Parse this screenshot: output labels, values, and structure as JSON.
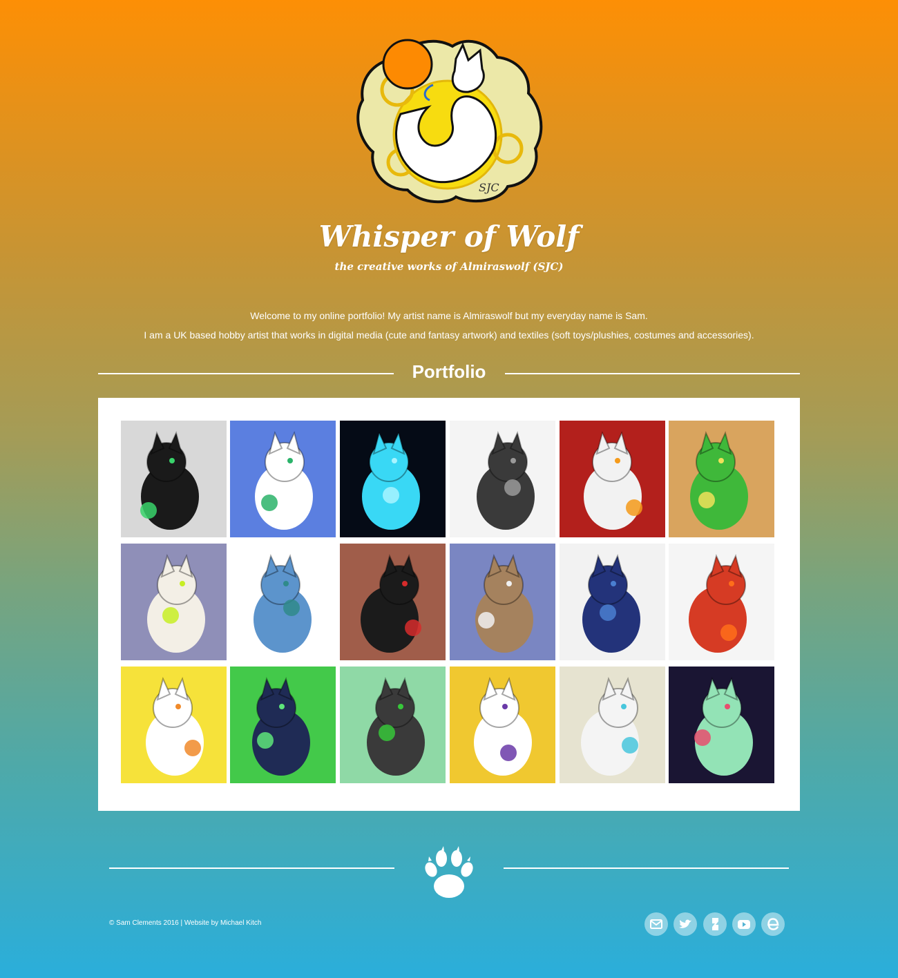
{
  "header": {
    "logo_icon": "sleeping-wolf-logo",
    "logo_signature": "SJC",
    "title": "Whisper of Wolf",
    "subtitle": "the creative works of Almiraswolf (SJC)"
  },
  "intro": {
    "line1": "Welcome to my online portfolio! My artist name is Almiraswolf but my everyday name is Sam.",
    "line2": "I am a UK based hobby artist that works in digital media (cute and fantasy artwork) and textiles (soft toys/plushies, costumes and accessories)."
  },
  "portfolio": {
    "heading": "Portfolio",
    "items": [
      {
        "subject": "black-dragon-costume-photo",
        "bg": "#d8d8d8",
        "fg": "#1a1a1a",
        "accent": "#39d36b"
      },
      {
        "subject": "white-fox-art",
        "bg": "#5b7fe0",
        "fg": "#ffffff",
        "accent": "#2bb36a"
      },
      {
        "subject": "glowing-ice-dragon-art",
        "bg": "#050b16",
        "fg": "#39d8f5",
        "accent": "#a8f4ff"
      },
      {
        "subject": "lineart-eastern-dragon",
        "bg": "#f4f4f4",
        "fg": "#3a3a3a",
        "accent": "#9a9a9a"
      },
      {
        "subject": "fire-wolf-art",
        "bg": "#b3201c",
        "fg": "#f2f2f2",
        "accent": "#f59a1a"
      },
      {
        "subject": "green-dinosaur-art",
        "bg": "#d9a45e",
        "fg": "#3fb83a",
        "accent": "#f0e05a"
      },
      {
        "subject": "white-fleece-dragon-plush",
        "bg": "#8f8fb8",
        "fg": "#f3efe6",
        "accent": "#c7ee24"
      },
      {
        "subject": "blue-dragon-art",
        "bg": "#ffffff",
        "fg": "#5c94cc",
        "accent": "#2f8a8a"
      },
      {
        "subject": "costume-person-photo",
        "bg": "#a05d4a",
        "fg": "#1b1b1b",
        "accent": "#d62b2b"
      },
      {
        "subject": "plush-antlers-collage",
        "bg": "#7a86c2",
        "fg": "#a5825e",
        "accent": "#f0f0f0"
      },
      {
        "subject": "blue-plush-creature",
        "bg": "#f2f2f2",
        "fg": "#23337a",
        "accent": "#4a7fd0"
      },
      {
        "subject": "red-fox-plush",
        "bg": "#f5f5f5",
        "fg": "#d63b24",
        "accent": "#ff6e1a"
      },
      {
        "subject": "almiraswolf-badge-art",
        "bg": "#f6e23a",
        "fg": "#ffffff",
        "accent": "#f08a2a"
      },
      {
        "subject": "green-star-hoodie",
        "bg": "#43c94a",
        "fg": "#1f2b55",
        "accent": "#5ee57a"
      },
      {
        "subject": "green-black-wolf-art",
        "bg": "#8fd9a6",
        "fg": "#3a3a3a",
        "accent": "#37c73a"
      },
      {
        "subject": "stained-glass-wolf-art",
        "bg": "#f0c830",
        "fg": "#ffffff",
        "accent": "#6a3aa8"
      },
      {
        "subject": "white-blue-wolf-art",
        "bg": "#e6e3d0",
        "fg": "#f4f4f4",
        "accent": "#48c6dc"
      },
      {
        "subject": "space-creature-reference",
        "bg": "#1a1533",
        "fg": "#93e3b6",
        "accent": "#e84e6e"
      }
    ]
  },
  "footer": {
    "divider_icon": "paw-print-icon",
    "copyright": "© Sam Clements 2016 | Website by Michael Kitch",
    "social": [
      {
        "icon": "email-icon"
      },
      {
        "icon": "twitter-icon"
      },
      {
        "icon": "deviantart-icon"
      },
      {
        "icon": "youtube-icon"
      },
      {
        "icon": "etsy-icon"
      }
    ]
  }
}
